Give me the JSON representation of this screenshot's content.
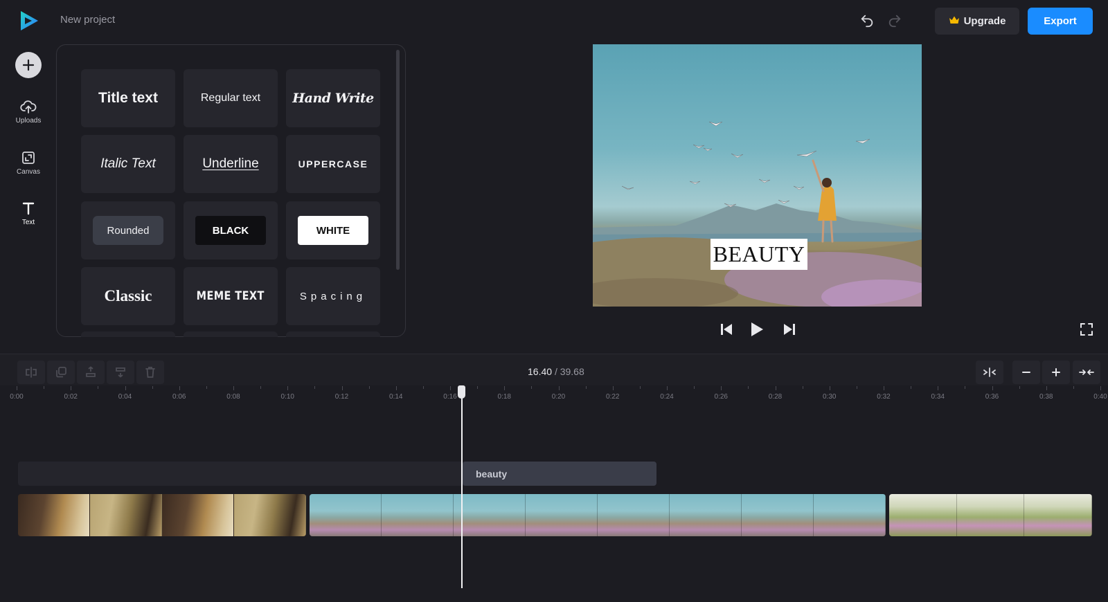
{
  "header": {
    "project_name": "New project",
    "upgrade_label": "Upgrade",
    "export_label": "Export"
  },
  "sidebar": {
    "items": [
      {
        "label": "Uploads",
        "icon": "upload-cloud-icon"
      },
      {
        "label": "Canvas",
        "icon": "canvas-icon"
      },
      {
        "label": "Text",
        "icon": "text-icon"
      }
    ],
    "active": "Text"
  },
  "text_styles": [
    "Title text",
    "Regular text",
    "Hand Write",
    "Italic Text",
    "Underline",
    "UPPERCASE",
    "Rounded",
    "BLACK",
    "WHITE",
    "Classic",
    "MEME TEXT",
    "Spacing"
  ],
  "preview": {
    "caption": "BEAUTY"
  },
  "timeline": {
    "current_time": "16.40",
    "separator": "/",
    "total_time": "39.68",
    "ruler_ticks": [
      "0:00",
      "0:02",
      "0:04",
      "0:06",
      "0:08",
      "0:10",
      "0:12",
      "0:14",
      "0:16",
      "0:18",
      "0:20",
      "0:22",
      "0:24",
      "0:26",
      "0:28",
      "0:30",
      "0:32",
      "0:34",
      "0:36",
      "0:38",
      "0:40"
    ],
    "text_clip_label": "beauty",
    "playhead_seconds": 16.4
  },
  "colors": {
    "accent": "#1a8cff",
    "background": "#1c1c22",
    "upgrade_crown": "#f5b800"
  }
}
